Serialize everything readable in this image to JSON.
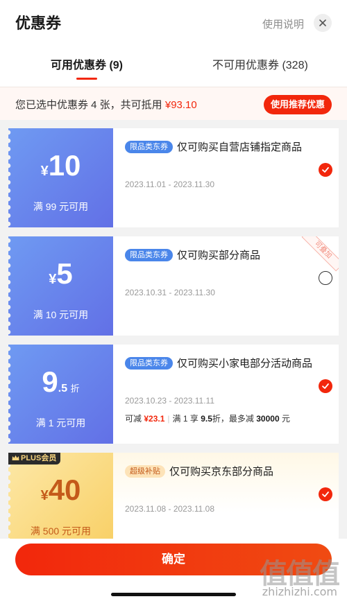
{
  "header": {
    "title": "优惠券",
    "help_label": "使用说明"
  },
  "tabs": [
    {
      "label": "可用优惠券 (9)",
      "active": true
    },
    {
      "label": "不可用优惠券 (328)",
      "active": false
    }
  ],
  "summary": {
    "text": "您已选中优惠券 4 张，共可抵用",
    "amount": "¥93.10",
    "recommend_label": "使用推荐优惠"
  },
  "coupons": [
    {
      "currency": "¥",
      "amount": "10",
      "suffix": "",
      "threshold": "满 99 元可用",
      "tag": "限品类东券",
      "description": "仅可购买自营店铺指定商品",
      "date": "2023.11.01 - 2023.11.30",
      "selected": true
    },
    {
      "currency": "¥",
      "amount": "5",
      "suffix": "",
      "threshold": "满 10 元可用",
      "tag": "限品类东券",
      "description": "仅可购买部分商品",
      "date": "2023.10.31 - 2023.11.30",
      "ribbon": "可叠加",
      "selected": false
    },
    {
      "currency": "",
      "amount": "9",
      "decimal": ".5",
      "suffix": "折",
      "threshold": "满 1 元可用",
      "tag": "限品类东券",
      "description": "仅可购买小家电部分活动商品",
      "date": "2023.10.23 - 2023.11.11",
      "extra_prefix": "可减",
      "extra_amount": "¥23.1",
      "extra_rule_prefix": "满 1 享",
      "extra_rule_discount": "9.5",
      "extra_rule_mid": "折，最多减",
      "extra_rule_max": "30000",
      "extra_rule_suffix": "元",
      "selected": true
    },
    {
      "badge": "PLUS会员",
      "currency": "¥",
      "amount": "40",
      "suffix": "",
      "threshold": "满 500 元可用",
      "tag": "超级补贴",
      "description": "仅可购买京东部分商品",
      "date": "2023.11.08 - 2023.11.08",
      "selected": true
    }
  ],
  "footer": {
    "confirm_label": "确定",
    "watermark_logo": "值值值",
    "watermark_url": "zhizhizhi.com"
  },
  "colors": {
    "accent": "#f2270c",
    "coupon_blue": "#6270e6",
    "plus_gold": "#f8cf64"
  }
}
